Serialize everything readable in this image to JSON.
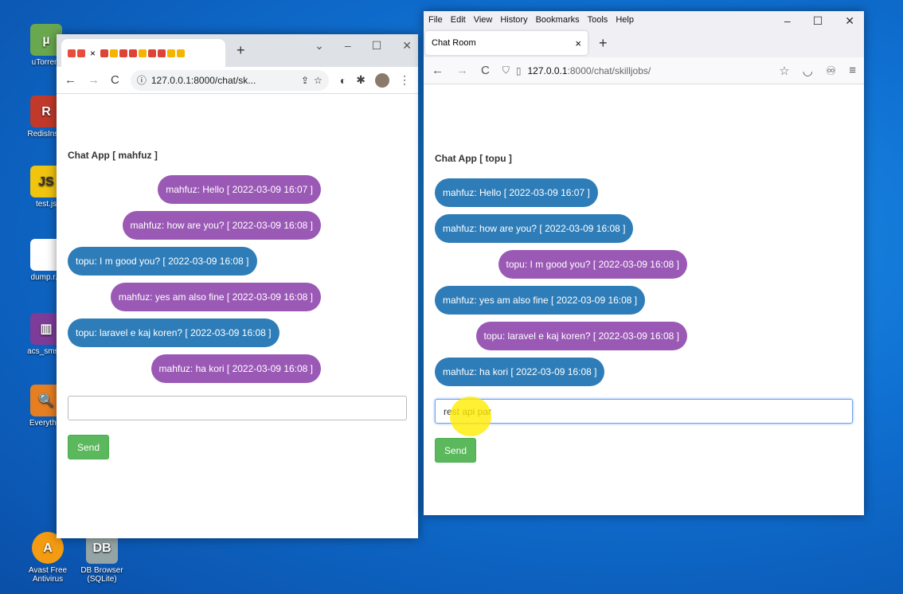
{
  "desktop": {
    "icons": [
      {
        "label": "uTorrent",
        "glyph": "µ",
        "color": "#6aa84f"
      },
      {
        "label": "RedisIns...",
        "glyph": "R",
        "color": "#c0392b"
      },
      {
        "label": "test.js",
        "glyph": "JS",
        "color": "#f1c40f"
      },
      {
        "label": "dump.r...",
        "glyph": "",
        "color": "#ffffff"
      },
      {
        "label": "acs_sms...",
        "glyph": "▥",
        "color": "#7d3c98"
      },
      {
        "label": "Everyth...",
        "glyph": "🔍",
        "color": "#e67e22"
      },
      {
        "label": "Avast Free Antivirus",
        "glyph": "A",
        "color": "#f39c12"
      },
      {
        "label": "DB Browser (SQLite)",
        "glyph": "DB",
        "color": "#95a5a6"
      }
    ]
  },
  "chrome": {
    "new_tab": "+",
    "url_host": "127.0.0.1",
    "url_rest": ":8000/chat/sk...",
    "chat_title": "Chat App [ mahfuz ]",
    "messages": [
      {
        "text": "mahfuz: Hello [ 2022-03-09 16:07 ]"
      },
      {
        "text": "mahfuz: how are you? [ 2022-03-09 16:08 ]"
      },
      {
        "text": "topu: I m good you? [ 2022-03-09 16:08 ]"
      },
      {
        "text": "mahfuz: yes am also fine [ 2022-03-09 16:08 ]"
      },
      {
        "text": "topu: laravel e kaj koren? [ 2022-03-09 16:08 ]"
      },
      {
        "text": "mahfuz: ha kori [ 2022-03-09 16:08 ]"
      }
    ],
    "input_value": "",
    "send_label": "Send"
  },
  "firefox": {
    "menu": [
      "File",
      "Edit",
      "View",
      "History",
      "Bookmarks",
      "Tools",
      "Help"
    ],
    "tab_title": "Chat Room",
    "tab_close": "×",
    "new_tab": "+",
    "url_host": "127.0.0.1",
    "url_rest": ":8000/chat/skilljobs/",
    "chat_title": "Chat App [ topu ]",
    "messages": [
      {
        "text": "mahfuz: Hello [ 2022-03-09 16:07 ]"
      },
      {
        "text": "mahfuz: how are you? [ 2022-03-09 16:08 ]"
      },
      {
        "text": "topu: I m good you? [ 2022-03-09 16:08 ]"
      },
      {
        "text": "mahfuz: yes am also fine [ 2022-03-09 16:08 ]"
      },
      {
        "text": "topu: laravel e kaj koren? [ 2022-03-09 16:08 ]"
      },
      {
        "text": "mahfuz: ha kori [ 2022-03-09 16:08 ]"
      }
    ],
    "input_value": "rest api par",
    "send_label": "Send"
  },
  "colors": {
    "own_message": "#9b59b6",
    "other_message": "#2e7db8",
    "send_button": "#5cb85c"
  }
}
